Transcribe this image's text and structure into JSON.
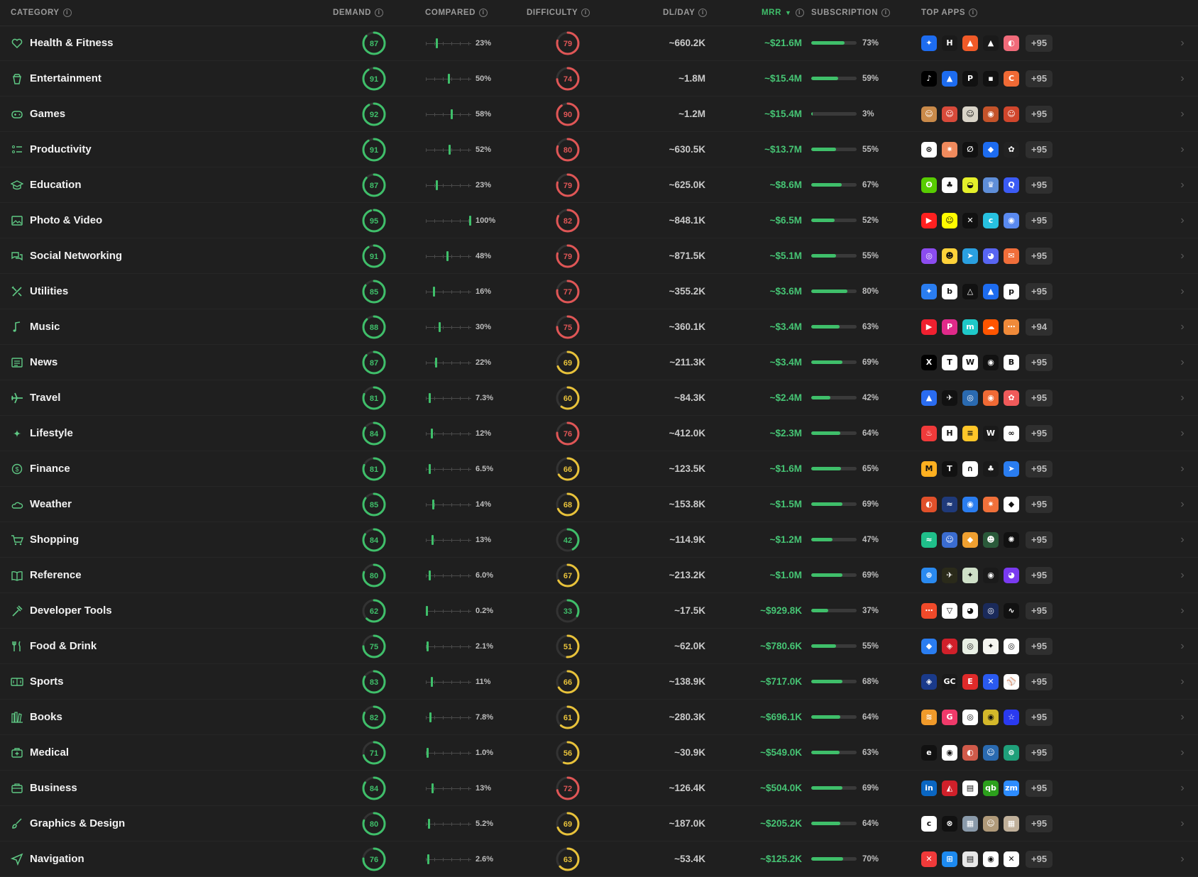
{
  "header": {
    "category": "CATEGORY",
    "demand": "DEMAND",
    "compared": "COMPARED",
    "difficulty": "DIFFICULTY",
    "dlday": "DL/DAY",
    "mrr": "MRR",
    "subscription": "SUBSCRIPTION",
    "topapps": "TOP APPS"
  },
  "colors": {
    "green": "#3fbf6a",
    "red": "#e05656",
    "yellow": "#e8c23a",
    "background": "#1f1f1f"
  },
  "rows": [
    {
      "name": "Health & Fitness",
      "icon": "heart-icon",
      "demand": 87,
      "compared": 23,
      "compared_label": "23%",
      "difficulty": 79,
      "dl": "~660.2K",
      "mrr": "~$21.6M",
      "sub": 73,
      "sub_label": "73%",
      "apps": [
        [
          "#1d6cf0",
          "✦"
        ],
        [
          "#1a1a1a",
          "H"
        ],
        [
          "#f05a28",
          "▲"
        ],
        [
          "#1a1a1a",
          "▲"
        ],
        [
          "#f06b7a",
          "◐"
        ]
      ],
      "more": "+95"
    },
    {
      "name": "Entertainment",
      "icon": "popcorn-icon",
      "demand": 91,
      "compared": 50,
      "compared_label": "50%",
      "difficulty": 74,
      "dl": "~1.8M",
      "mrr": "~$15.4M",
      "sub": 59,
      "sub_label": "59%",
      "apps": [
        [
          "#000000",
          "♪"
        ],
        [
          "#1d6cf0",
          "▲"
        ],
        [
          "#111111",
          "P"
        ],
        [
          "#111111",
          "▪"
        ],
        [
          "#f06a35",
          "C"
        ]
      ],
      "more": "+95"
    },
    {
      "name": "Games",
      "icon": "gamepad-icon",
      "demand": 92,
      "compared": 58,
      "compared_label": "58%",
      "difficulty": 90,
      "dl": "~1.2M",
      "mrr": "~$15.4M",
      "sub": 3,
      "sub_label": "3%",
      "apps": [
        [
          "#c98a4a",
          "☺"
        ],
        [
          "#d84a3a",
          "☺"
        ],
        [
          "#d9d4c8",
          "☺"
        ],
        [
          "#c4532a",
          "◉"
        ],
        [
          "#d0462c",
          "☺"
        ]
      ],
      "more": "+95"
    },
    {
      "name": "Productivity",
      "icon": "checklist-icon",
      "demand": 91,
      "compared": 52,
      "compared_label": "52%",
      "difficulty": 80,
      "dl": "~630.5K",
      "mrr": "~$13.7M",
      "sub": 55,
      "sub_label": "55%",
      "apps": [
        [
          "#ffffff",
          "⊛"
        ],
        [
          "#f08a5d",
          "✷"
        ],
        [
          "#111111",
          "∅"
        ],
        [
          "#1d6cf0",
          "◆"
        ],
        [
          "#222222",
          "✿"
        ]
      ],
      "more": "+95"
    },
    {
      "name": "Education",
      "icon": "graduation-cap-icon",
      "demand": 87,
      "compared": 23,
      "compared_label": "23%",
      "difficulty": 79,
      "dl": "~625.0K",
      "mrr": "~$8.6M",
      "sub": 67,
      "sub_label": "67%",
      "apps": [
        [
          "#58cc02",
          "ʘ"
        ],
        [
          "#ffffff",
          "♣"
        ],
        [
          "#e5f02a",
          "◒"
        ],
        [
          "#5f8ed8",
          "♛"
        ],
        [
          "#3b5bf5",
          "Q"
        ]
      ],
      "more": "+95"
    },
    {
      "name": "Photo & Video",
      "icon": "photo-icon",
      "demand": 95,
      "compared": 100,
      "compared_label": "100%",
      "difficulty": 82,
      "dl": "~848.1K",
      "mrr": "~$6.5M",
      "sub": 52,
      "sub_label": "52%",
      "apps": [
        [
          "#ff2020",
          "▶"
        ],
        [
          "#fffc00",
          "☺"
        ],
        [
          "#111111",
          "✕"
        ],
        [
          "#27c1e0",
          "c"
        ],
        [
          "#5a8af0",
          "◉"
        ]
      ],
      "more": "+95"
    },
    {
      "name": "Social Networking",
      "icon": "chat-bubbles-icon",
      "demand": 91,
      "compared": 48,
      "compared_label": "48%",
      "difficulty": 79,
      "dl": "~871.5K",
      "mrr": "~$5.1M",
      "sub": 55,
      "sub_label": "55%",
      "apps": [
        [
          "#8c4cf0",
          "◎"
        ],
        [
          "#ffd23a",
          "☻"
        ],
        [
          "#2aa0e0",
          "➤"
        ],
        [
          "#5865f2",
          "◕"
        ],
        [
          "#f06e3a",
          "✉"
        ]
      ],
      "more": "+95"
    },
    {
      "name": "Utilities",
      "icon": "tools-icon",
      "demand": 85,
      "compared": 16,
      "compared_label": "16%",
      "difficulty": 77,
      "dl": "~355.2K",
      "mrr": "~$3.6M",
      "sub": 80,
      "sub_label": "80%",
      "apps": [
        [
          "#2a7df0",
          "✦"
        ],
        [
          "#ffffff",
          "b"
        ],
        [
          "#111111",
          "△"
        ],
        [
          "#1d6cf0",
          "▲"
        ],
        [
          "#ffffff",
          "p"
        ]
      ],
      "more": "+95"
    },
    {
      "name": "Music",
      "icon": "music-note-icon",
      "demand": 88,
      "compared": 30,
      "compared_label": "30%",
      "difficulty": 75,
      "dl": "~360.1K",
      "mrr": "~$3.4M",
      "sub": 63,
      "sub_label": "63%",
      "apps": [
        [
          "#f02030",
          "▶"
        ],
        [
          "#e02a8a",
          "P"
        ],
        [
          "#1fc9c9",
          "m"
        ],
        [
          "#ff5500",
          "☁"
        ],
        [
          "#f08a3a",
          "⋯"
        ]
      ],
      "more": "+94"
    },
    {
      "name": "News",
      "icon": "newspaper-icon",
      "demand": 87,
      "compared": 22,
      "compared_label": "22%",
      "difficulty": 69,
      "dl": "~211.3K",
      "mrr": "~$3.4M",
      "sub": 69,
      "sub_label": "69%",
      "apps": [
        [
          "#000000",
          "X"
        ],
        [
          "#ffffff",
          "T"
        ],
        [
          "#ffffff",
          "W"
        ],
        [
          "#111111",
          "◉"
        ],
        [
          "#ffffff",
          "B"
        ]
      ],
      "more": "+95"
    },
    {
      "name": "Travel",
      "icon": "airplane-icon",
      "demand": 81,
      "compared": 7.3,
      "compared_label": "7.3%",
      "difficulty": 60,
      "dl": "~84.3K",
      "mrr": "~$2.4M",
      "sub": 42,
      "sub_label": "42%",
      "apps": [
        [
          "#2a6cf0",
          "▲"
        ],
        [
          "#111111",
          "✈"
        ],
        [
          "#2a6ab0",
          "◎"
        ],
        [
          "#f06a35",
          "◉"
        ],
        [
          "#f05a5a",
          "✿"
        ]
      ],
      "more": "+95"
    },
    {
      "name": "Lifestyle",
      "icon": "sparkle-icon",
      "demand": 84,
      "compared": 12,
      "compared_label": "12%",
      "difficulty": 76,
      "dl": "~412.0K",
      "mrr": "~$2.3M",
      "sub": 64,
      "sub_label": "64%",
      "apps": [
        [
          "#f03a3a",
          "♨"
        ],
        [
          "#ffffff",
          "H"
        ],
        [
          "#ffc629",
          "≡"
        ],
        [
          "#1a1a1a",
          "W"
        ],
        [
          "#ffffff",
          "∞"
        ]
      ],
      "more": "+95"
    },
    {
      "name": "Finance",
      "icon": "dollar-circle-icon",
      "demand": 81,
      "compared": 6.5,
      "compared_label": "6.5%",
      "difficulty": 66,
      "dl": "~123.5K",
      "mrr": "~$1.6M",
      "sub": 65,
      "sub_label": "65%",
      "apps": [
        [
          "#ffb020",
          "M"
        ],
        [
          "#111111",
          "T"
        ],
        [
          "#ffffff",
          "∩"
        ],
        [
          "#1a1a1a",
          "♣"
        ],
        [
          "#2a7df0",
          "➤"
        ]
      ],
      "more": "+95"
    },
    {
      "name": "Weather",
      "icon": "cloud-sun-icon",
      "demand": 85,
      "compared": 14,
      "compared_label": "14%",
      "difficulty": 68,
      "dl": "~153.8K",
      "mrr": "~$1.5M",
      "sub": 69,
      "sub_label": "69%",
      "apps": [
        [
          "#e0502a",
          "◐"
        ],
        [
          "#1f3a7a",
          "≈"
        ],
        [
          "#2a7df0",
          "◉"
        ],
        [
          "#f0703a",
          "✷"
        ],
        [
          "#ffffff",
          "◆"
        ]
      ],
      "more": "+95"
    },
    {
      "name": "Shopping",
      "icon": "cart-icon",
      "demand": 84,
      "compared": 13,
      "compared_label": "13%",
      "difficulty": 42,
      "dl": "~114.9K",
      "mrr": "~$1.2M",
      "sub": 47,
      "sub_label": "47%",
      "apps": [
        [
          "#1fbf8a",
          "≈"
        ],
        [
          "#3a6cd0",
          "☺"
        ],
        [
          "#f0a030",
          "◆"
        ],
        [
          "#2a5a3a",
          "☻"
        ],
        [
          "#111111",
          "✺"
        ]
      ],
      "more": "+95"
    },
    {
      "name": "Reference",
      "icon": "open-book-icon",
      "demand": 80,
      "compared": 6,
      "compared_label": "6.0%",
      "difficulty": 67,
      "dl": "~213.2K",
      "mrr": "~$1.0M",
      "sub": 69,
      "sub_label": "69%",
      "apps": [
        [
          "#2a8af0",
          "⊕"
        ],
        [
          "#2a2a1a",
          "✈"
        ],
        [
          "#cfe0c8",
          "✦"
        ],
        [
          "#1a1a1a",
          "◉"
        ],
        [
          "#7a3af0",
          "◕"
        ]
      ],
      "more": "+95"
    },
    {
      "name": "Developer Tools",
      "icon": "hammer-icon",
      "demand": 62,
      "compared": 0.2,
      "compared_label": "0.2%",
      "difficulty": 33,
      "dl": "~17.5K",
      "mrr": "~$929.8K",
      "sub": 37,
      "sub_label": "37%",
      "apps": [
        [
          "#f04a2a",
          "⋯"
        ],
        [
          "#ffffff",
          "▽"
        ],
        [
          "#ffffff",
          "◕"
        ],
        [
          "#1a2a5a",
          "◎"
        ],
        [
          "#111111",
          "∿"
        ]
      ],
      "more": "+95"
    },
    {
      "name": "Food & Drink",
      "icon": "fork-knife-icon",
      "demand": 75,
      "compared": 2.1,
      "compared_label": "2.1%",
      "difficulty": 51,
      "dl": "~62.0K",
      "mrr": "~$780.6K",
      "sub": 55,
      "sub_label": "55%",
      "apps": [
        [
          "#2a7df0",
          "◆"
        ],
        [
          "#d0202a",
          "◈"
        ],
        [
          "#e8efe4",
          "◎"
        ],
        [
          "#f5f5f0",
          "✦"
        ],
        [
          "#ffffff",
          "◎"
        ]
      ],
      "more": "+95"
    },
    {
      "name": "Sports",
      "icon": "scoreboard-icon",
      "demand": 83,
      "compared": 11,
      "compared_label": "11%",
      "difficulty": 66,
      "dl": "~138.9K",
      "mrr": "~$717.0K",
      "sub": 68,
      "sub_label": "68%",
      "apps": [
        [
          "#1a3a8a",
          "◈"
        ],
        [
          "#1a1a1a",
          "GC"
        ],
        [
          "#e02a2a",
          "E"
        ],
        [
          "#2a5af0",
          "✕"
        ],
        [
          "#ffffff",
          "⚾"
        ]
      ],
      "more": "+95"
    },
    {
      "name": "Books",
      "icon": "books-icon",
      "demand": 82,
      "compared": 7.8,
      "compared_label": "7.8%",
      "difficulty": 61,
      "dl": "~280.3K",
      "mrr": "~$696.1K",
      "sub": 64,
      "sub_label": "64%",
      "apps": [
        [
          "#f09a2a",
          "≋"
        ],
        [
          "#f03a6a",
          "G"
        ],
        [
          "#ffffff",
          "◎"
        ],
        [
          "#d4b82a",
          "◉"
        ],
        [
          "#2a3af0",
          "☆"
        ]
      ],
      "more": "+95"
    },
    {
      "name": "Medical",
      "icon": "medical-kit-icon",
      "demand": 71,
      "compared": 1,
      "compared_label": "1.0%",
      "difficulty": 56,
      "dl": "~30.9K",
      "mrr": "~$549.0K",
      "sub": 63,
      "sub_label": "63%",
      "apps": [
        [
          "#111111",
          "e"
        ],
        [
          "#ffffff",
          "◉"
        ],
        [
          "#d05a4a",
          "◐"
        ],
        [
          "#2a6ab0",
          "☺"
        ],
        [
          "#1fa07a",
          "⊜"
        ]
      ],
      "more": "+95"
    },
    {
      "name": "Business",
      "icon": "briefcase-icon",
      "demand": 84,
      "compared": 13,
      "compared_label": "13%",
      "difficulty": 72,
      "dl": "~126.4K",
      "mrr": "~$504.0K",
      "sub": 69,
      "sub_label": "69%",
      "apps": [
        [
          "#0a66c2",
          "in"
        ],
        [
          "#d0202a",
          "◭"
        ],
        [
          "#ffffff",
          "▤"
        ],
        [
          "#2ca01c",
          "qb"
        ],
        [
          "#2d8cff",
          "zm"
        ]
      ],
      "more": "+95"
    },
    {
      "name": "Graphics & Design",
      "icon": "brush-icon",
      "demand": 80,
      "compared": 5.2,
      "compared_label": "5.2%",
      "difficulty": 69,
      "dl": "~187.0K",
      "mrr": "~$205.2K",
      "sub": 64,
      "sub_label": "64%",
      "apps": [
        [
          "#ffffff",
          "c"
        ],
        [
          "#111111",
          "⊗"
        ],
        [
          "#8a9aaa",
          "▦"
        ],
        [
          "#b09a7a",
          "☺"
        ],
        [
          "#c0b09a",
          "▦"
        ]
      ],
      "more": "+95"
    },
    {
      "name": "Navigation",
      "icon": "navigation-arrow-icon",
      "demand": 76,
      "compared": 2.6,
      "compared_label": "2.6%",
      "difficulty": 63,
      "dl": "~53.4K",
      "mrr": "~$125.2K",
      "sub": 70,
      "sub_label": "70%",
      "apps": [
        [
          "#f03a3a",
          "✕"
        ],
        [
          "#1d8af0",
          "⊞"
        ],
        [
          "#e8e8e8",
          "▤"
        ],
        [
          "#ffffff",
          "◉"
        ],
        [
          "#ffffff",
          "✕"
        ]
      ],
      "more": "+95"
    }
  ]
}
